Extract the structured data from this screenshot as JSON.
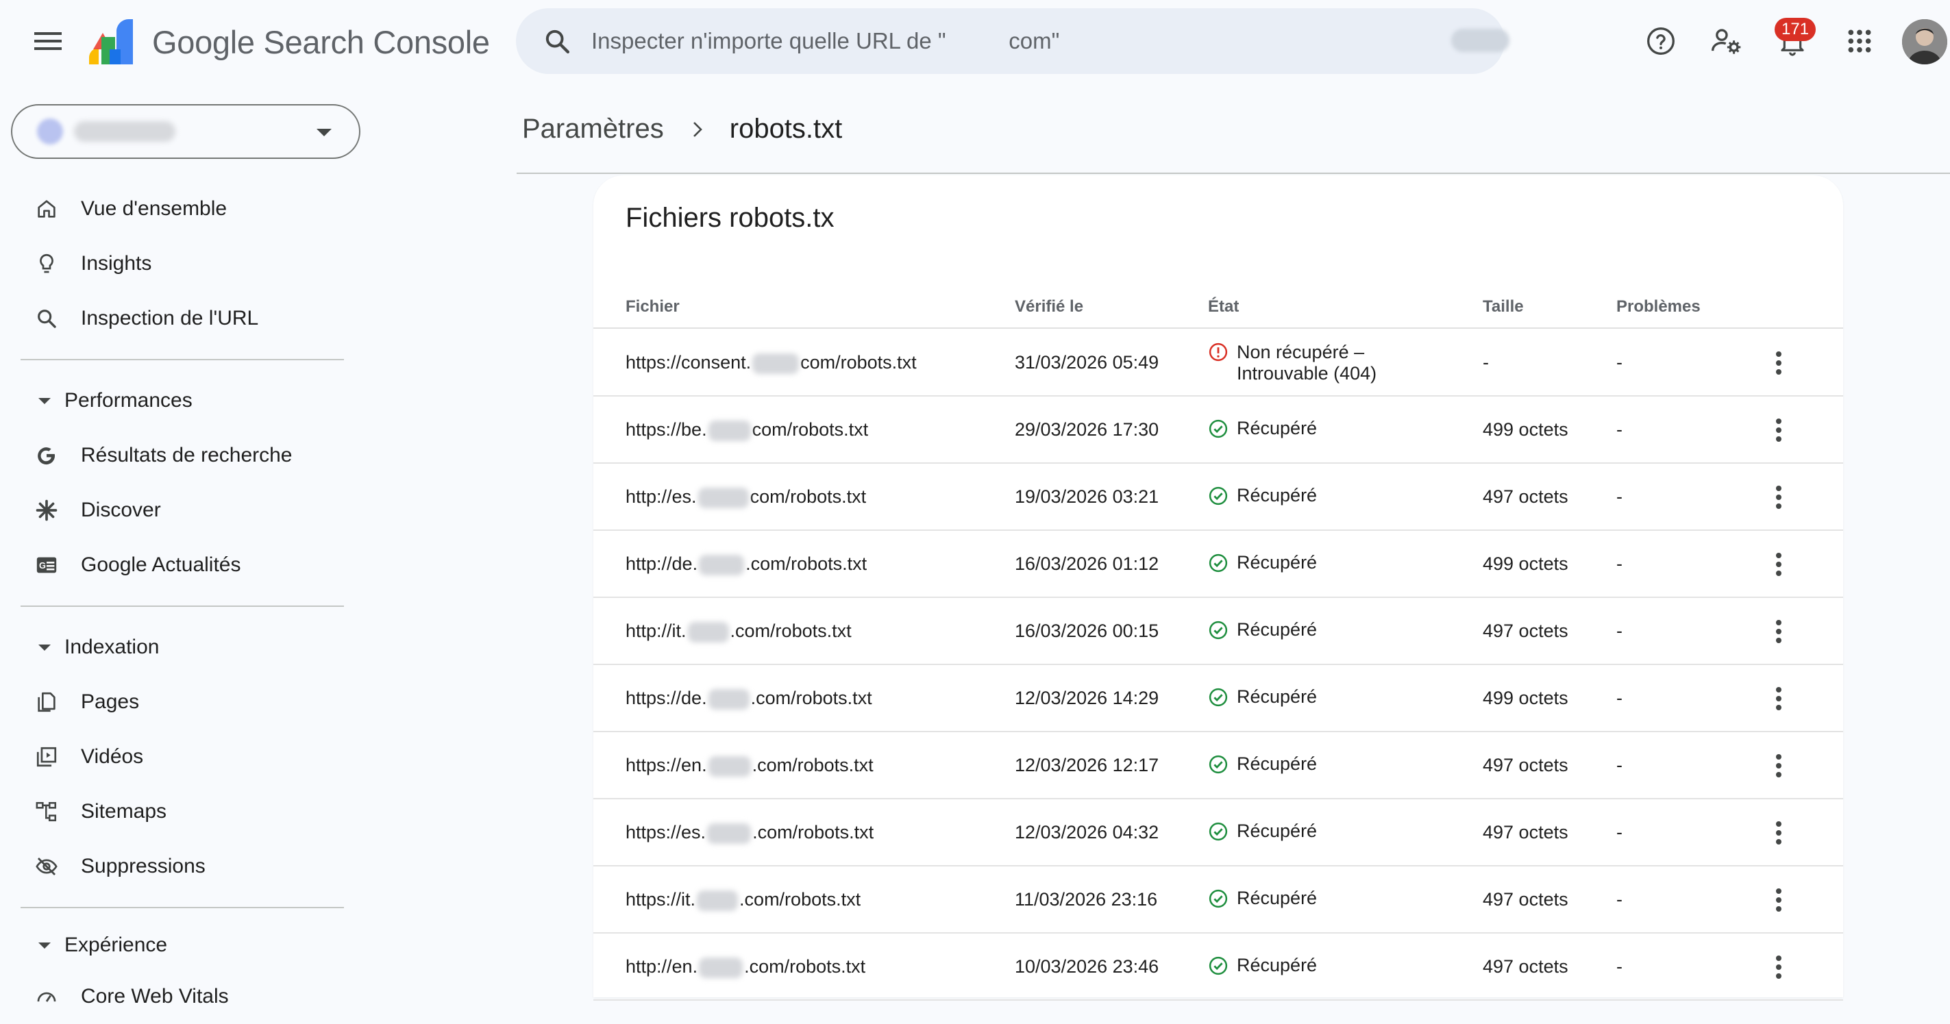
{
  "app": {
    "name": "Google Search Console",
    "menu_icon": "hamburger-menu-icon",
    "logo_icon": "search-console-logo"
  },
  "search": {
    "placeholder": "Inspecter n'importe quelle URL de \"          com\""
  },
  "toolbar": {
    "help_icon": "help-icon",
    "user_settings_icon": "manage-users-icon",
    "notifications_icon": "bell-icon",
    "notifications_count": "171",
    "apps_icon": "apps-grid-icon",
    "avatar": "user-avatar"
  },
  "sidebar": {
    "items": [
      {
        "label": "Vue d'ensemble",
        "icon": "home-icon"
      },
      {
        "label": "Insights",
        "icon": "lightbulb-icon"
      },
      {
        "label": "Inspection de l'URL",
        "icon": "search-icon"
      }
    ],
    "performances": {
      "label": "Performances",
      "items": [
        {
          "label": "Résultats de recherche",
          "icon": "google-g-icon"
        },
        {
          "label": "Discover",
          "icon": "asterisk-icon"
        },
        {
          "label": "Google Actualités",
          "icon": "news-icon"
        }
      ]
    },
    "indexation": {
      "label": "Indexation",
      "items": [
        {
          "label": "Pages",
          "icon": "pages-icon"
        },
        {
          "label": "Vidéos",
          "icon": "video-library-icon"
        },
        {
          "label": "Sitemaps",
          "icon": "sitemap-icon"
        },
        {
          "label": "Suppressions",
          "icon": "visibility-off-icon"
        }
      ]
    },
    "experience": {
      "label": "Expérience",
      "items": [
        {
          "label": "Core Web Vitals",
          "icon": "speed-icon"
        }
      ]
    }
  },
  "breadcrumb": {
    "parent": "Paramètres",
    "current": "robots.txt"
  },
  "card": {
    "title": "Fichiers robots.tx",
    "columns": {
      "file": "Fichier",
      "checked": "Vérifié le",
      "state": "État",
      "size": "Taille",
      "problems": "Problèmes"
    },
    "rows": [
      {
        "file_prefix": "https://consent.",
        "file_suffix": "com/robots.txt",
        "date": "31/03/2026 05:49",
        "state_line1": "Non récupéré –",
        "state_line2": "Introuvable (404)",
        "status": "error",
        "size": "-",
        "problems": "-"
      },
      {
        "file_prefix": "https://be.",
        "file_suffix": "com/robots.txt",
        "date": "29/03/2026 17:30",
        "state_line1": "Récupéré",
        "state_line2": "",
        "status": "ok",
        "size": "499 octets",
        "problems": "-"
      },
      {
        "file_prefix": "http://es.",
        "file_suffix": "com/robots.txt",
        "date": "19/03/2026 03:21",
        "state_line1": "Récupéré",
        "state_line2": "",
        "status": "ok",
        "size": "497 octets",
        "problems": "-"
      },
      {
        "file_prefix": "http://de.",
        "file_suffix": ".com/robots.txt",
        "date": "16/03/2026 01:12",
        "state_line1": "Récupéré",
        "state_line2": "",
        "status": "ok",
        "size": "499 octets",
        "problems": "-"
      },
      {
        "file_prefix": "http://it.",
        "file_suffix": ".com/robots.txt",
        "date": "16/03/2026 00:15",
        "state_line1": "Récupéré",
        "state_line2": "",
        "status": "ok",
        "size": "497 octets",
        "problems": "-"
      },
      {
        "file_prefix": "https://de.",
        "file_suffix": ".com/robots.txt",
        "date": "12/03/2026 14:29",
        "state_line1": "Récupéré",
        "state_line2": "",
        "status": "ok",
        "size": "499 octets",
        "problems": "-"
      },
      {
        "file_prefix": "https://en.",
        "file_suffix": ".com/robots.txt",
        "date": "12/03/2026 12:17",
        "state_line1": "Récupéré",
        "state_line2": "",
        "status": "ok",
        "size": "497 octets",
        "problems": "-"
      },
      {
        "file_prefix": "https://es.",
        "file_suffix": ".com/robots.txt",
        "date": "12/03/2026 04:32",
        "state_line1": "Récupéré",
        "state_line2": "",
        "status": "ok",
        "size": "497 octets",
        "problems": "-"
      },
      {
        "file_prefix": "https://it.",
        "file_suffix": ".com/robots.txt",
        "date": "11/03/2026 23:16",
        "state_line1": "Récupéré",
        "state_line2": "",
        "status": "ok",
        "size": "497 octets",
        "problems": "-"
      },
      {
        "file_prefix": "http://en.",
        "file_suffix": ".com/robots.txt",
        "date": "10/03/2026 23:46",
        "state_line1": "Récupéré",
        "state_line2": "",
        "status": "ok",
        "size": "497 octets",
        "problems": "-"
      }
    ],
    "row_menu_icon": "more-vert-icon"
  },
  "colors": {
    "background": "#f8fafd",
    "search_bg": "#e9eef6",
    "ok_green": "#1e8e3e",
    "error_red": "#d93025",
    "badge_red": "#d93025",
    "logo_blue": "#4285f4",
    "logo_yellow": "#fbbc04",
    "logo_red": "#ea4335",
    "logo_green": "#34a853"
  }
}
